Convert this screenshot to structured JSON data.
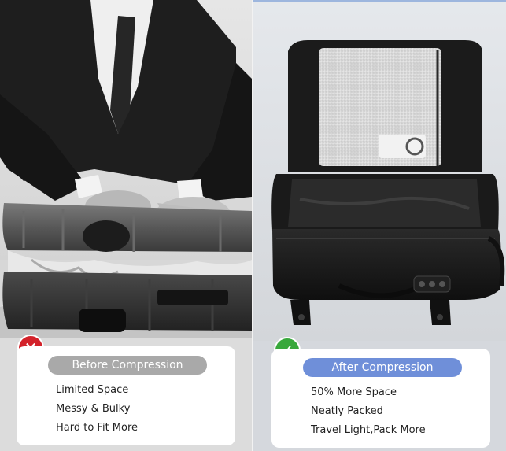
{
  "before": {
    "label": "Before Compression",
    "items": [
      "Limited Space",
      "Messy & Bulky",
      "Hard to Fit More"
    ],
    "badge_icon": "x-mark-icon",
    "badge_color": "#d3222a",
    "pill_color": "#a9a9a9"
  },
  "after": {
    "label": "After Compression",
    "items": [
      "50% More Space",
      "Neatly Packed",
      "Travel Light,Pack More"
    ],
    "badge_icon": "check-mark-icon",
    "badge_color": "#38a83c",
    "pill_color": "#6f8fd9"
  }
}
